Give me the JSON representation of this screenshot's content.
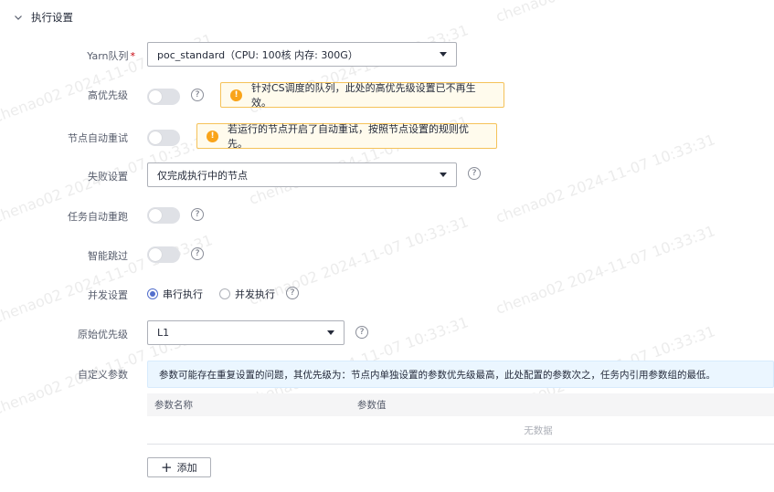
{
  "section": {
    "title": "执行设置"
  },
  "fields": {
    "yarn_queue": {
      "label": "Yarn队列",
      "required_mark": "*",
      "value": "poc_standard（CPU: 100核 内存: 300G）"
    },
    "high_priority": {
      "label": "高优先级",
      "toggle_on": false,
      "warning": "针对CS调度的队列，此处的高优先级设置已不再生效。"
    },
    "node_auto_retry": {
      "label": "节点自动重试",
      "toggle_on": false,
      "warning": "若运行的节点开启了自动重试，按照节点设置的规则优先。"
    },
    "failure_setting": {
      "label": "失败设置",
      "value": "仅完成执行中的节点"
    },
    "task_auto_rerun": {
      "label": "任务自动重跑",
      "toggle_on": false
    },
    "smart_skip": {
      "label": "智能跳过",
      "toggle_on": false
    },
    "concurrency": {
      "label": "并发设置",
      "options": [
        "串行执行",
        "并发执行"
      ],
      "selected": "串行执行"
    },
    "original_priority": {
      "label": "原始优先级",
      "value": "L1"
    },
    "custom_params": {
      "label": "自定义参数",
      "info": "参数可能存在重复设置的问题，其优先级为：节点内单独设置的参数优先级最高，此处配置的参数次之，任务内引用参数组的最低。",
      "columns": [
        "参数名称",
        "参数值"
      ],
      "empty_text": "无数据",
      "add_label": "添加"
    }
  },
  "help_glyph": "?",
  "warning_glyph": "!",
  "watermark": "chenao02 2024-11-07 10:33:31",
  "colors": {
    "primary": "#526ecc",
    "warning_bg": "#fffbed",
    "warning_border": "#f5c259",
    "info_bg": "#ebf6ff"
  }
}
